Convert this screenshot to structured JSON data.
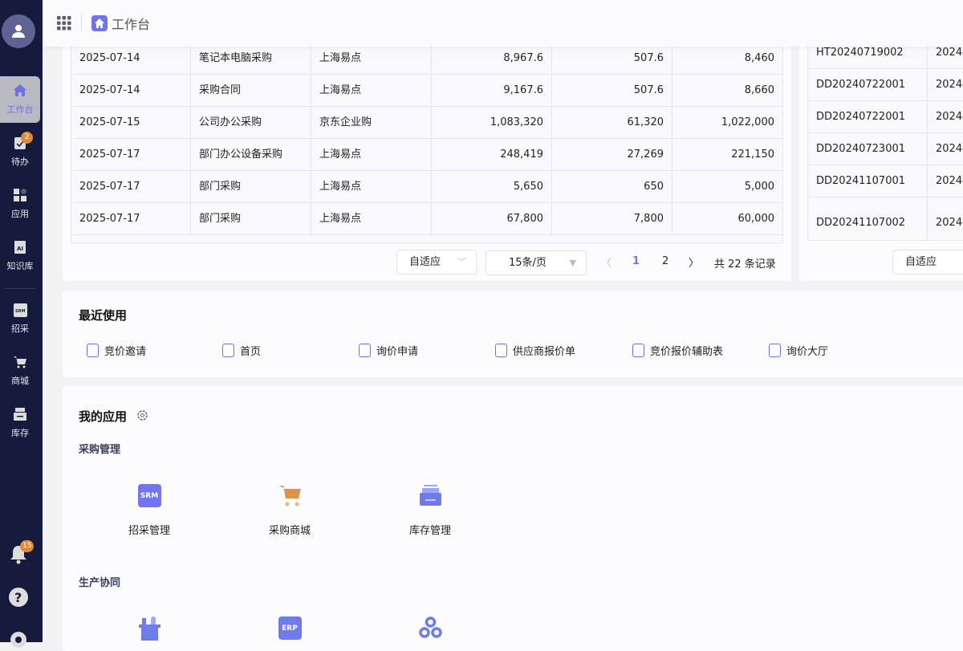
{
  "header": {
    "title": "工作台"
  },
  "sidebar": {
    "items": [
      {
        "label": "工作台",
        "icon": "home-icon"
      },
      {
        "label": "待办",
        "icon": "clipboard-check-icon",
        "badge": "2"
      },
      {
        "label": "应用",
        "icon": "apps-icon"
      },
      {
        "label": "知识库",
        "icon": "ai-book-icon"
      },
      {
        "label": "招采",
        "icon": "srm-icon"
      },
      {
        "label": "商城",
        "icon": "cart-icon"
      },
      {
        "label": "库存",
        "icon": "inventory-icon"
      }
    ],
    "notifications_badge": "15"
  },
  "left_table": {
    "rows": [
      [
        "2025-07-14",
        "笔记本电脑采购",
        "上海易点",
        "8,967.6",
        "507.6",
        "8,460"
      ],
      [
        "2025-07-14",
        "采购合同",
        "上海易点",
        "9,167.6",
        "507.6",
        "8,660"
      ],
      [
        "2025-07-15",
        "公司办公采购",
        "京东企业购",
        "1,083,320",
        "61,320",
        "1,022,000"
      ],
      [
        "2025-07-17",
        "部门办公设备采购",
        "上海易点",
        "248,419",
        "27,269",
        "221,150"
      ],
      [
        "2025-07-17",
        "部门采购",
        "上海易点",
        "5,650",
        "650",
        "5,000"
      ],
      [
        "2025-07-17",
        "部门采购",
        "上海易点",
        "67,800",
        "7,800",
        "60,000"
      ]
    ],
    "pagination": {
      "fit": "自适应",
      "page_size": "15条/页",
      "pages": [
        "1",
        "2"
      ],
      "current": "1",
      "total": "共 22 条记录"
    }
  },
  "right_table": {
    "rows": [
      [
        "HT20240719002",
        "2024-"
      ],
      [
        "DD20240722001",
        "2024-"
      ],
      [
        "DD20240722001",
        "2024-"
      ],
      [
        "DD20240723001",
        "2024-"
      ],
      [
        "DD20241107001",
        "2024-"
      ],
      [
        "DD20241107002",
        "2024-"
      ]
    ],
    "fit": "自适应"
  },
  "recent": {
    "title": "最近使用",
    "items": [
      "竞价邀请",
      "首页",
      "询价申请",
      "供应商报价单",
      "竞价报价辅助表",
      "询价大厅"
    ]
  },
  "my_apps": {
    "title": "我的应用",
    "groups": [
      {
        "name": "采购管理",
        "apps": [
          {
            "label": "招采管理",
            "icon_text": "SRM"
          },
          {
            "label": "采购商城"
          },
          {
            "label": "库存管理"
          }
        ]
      },
      {
        "name": "生产协同",
        "apps": [
          {
            "label": ""
          },
          {
            "label": "",
            "icon_text": "ERP"
          },
          {
            "label": ""
          }
        ]
      }
    ]
  },
  "colors": {
    "accent": "#6f74f0",
    "sidebar": "#161a3c",
    "badge": "#e08a3c"
  }
}
